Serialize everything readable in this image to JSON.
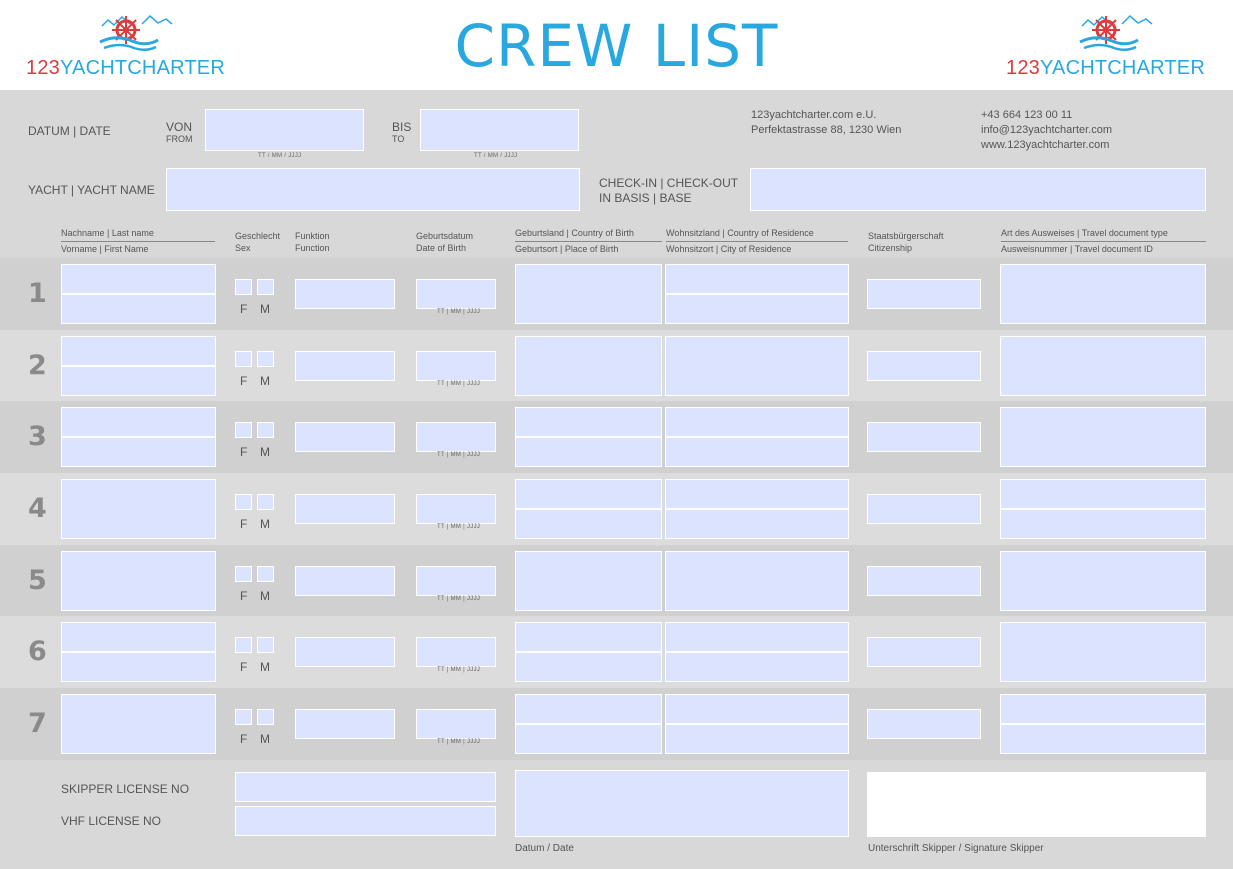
{
  "header": {
    "title": "CREW LIST",
    "logo_num": "123",
    "logo_name": "YACHTCHARTER"
  },
  "dates": {
    "label": "DATUM | DATE",
    "from_label": "VON",
    "from_sub": "FROM",
    "from_hint": "TT / MM / JJJJ",
    "to_label": "BIS",
    "to_sub": "TO",
    "to_hint": "TT / MM / JJJJ"
  },
  "company": {
    "name": "123yachtcharter.com e.U.",
    "address": "Perfektastrasse 88, 1230 Wien",
    "phone": "+43 664 123 00 11",
    "email": "info@123yachtcharter.com",
    "web": "www.123yachtcharter.com"
  },
  "yacht": {
    "label": "YACHT | YACHT NAME",
    "checkin_line1": "CHECK-IN | CHECK-OUT",
    "checkin_line2": "IN BASIS | BASE"
  },
  "columns": {
    "lastname": "Nachname | Last name",
    "firstname": "Vorname | First Name",
    "sex_de": "Geschlecht",
    "sex_en": "Sex",
    "func_de": "Funktion",
    "func_en": "Function",
    "dob_de": "Geburtsdatum",
    "dob_en": "Date of Birth",
    "cob": "Geburtsland | Country of Birth",
    "pob": "Geburtsort | Place of Birth",
    "cor": "Wohnsitzland | Country of Residence",
    "city": "Wohnsitzort | City of Residence",
    "cit_de": "Staatsbürgerschaft",
    "cit_en": "Citizenship",
    "doctype": "Art des Ausweises | Travel document type",
    "docid": "Ausweisnummer | Travel document ID"
  },
  "rows": [
    {
      "num": "1",
      "female": "F",
      "male": "M",
      "dob_hint": "TT | MM | JJJJ"
    },
    {
      "num": "2",
      "female": "F",
      "male": "M",
      "dob_hint": "TT | MM | JJJJ"
    },
    {
      "num": "3",
      "female": "F",
      "male": "M",
      "dob_hint": "TT | MM | JJJJ"
    },
    {
      "num": "4",
      "female": "F",
      "male": "M",
      "dob_hint": "TT | MM | JJJJ"
    },
    {
      "num": "5",
      "female": "F",
      "male": "M",
      "dob_hint": "TT | MM | JJJJ"
    },
    {
      "num": "6",
      "female": "F",
      "male": "M",
      "dob_hint": "TT | MM | JJJJ"
    },
    {
      "num": "7",
      "female": "F",
      "male": "M",
      "dob_hint": "TT | MM | JJJJ"
    }
  ],
  "footer": {
    "skipper_label": "SKIPPER LICENSE NO",
    "vhf_label": "VHF LICENSE NO",
    "date_label": "Datum / Date",
    "signature_label": "Unterschrift Skipper / Signature Skipper"
  },
  "colors": {
    "accent": "#29a8e0",
    "brand_red": "#e03a3e",
    "field": "#dce3ff",
    "background": "#d8d8d8"
  }
}
